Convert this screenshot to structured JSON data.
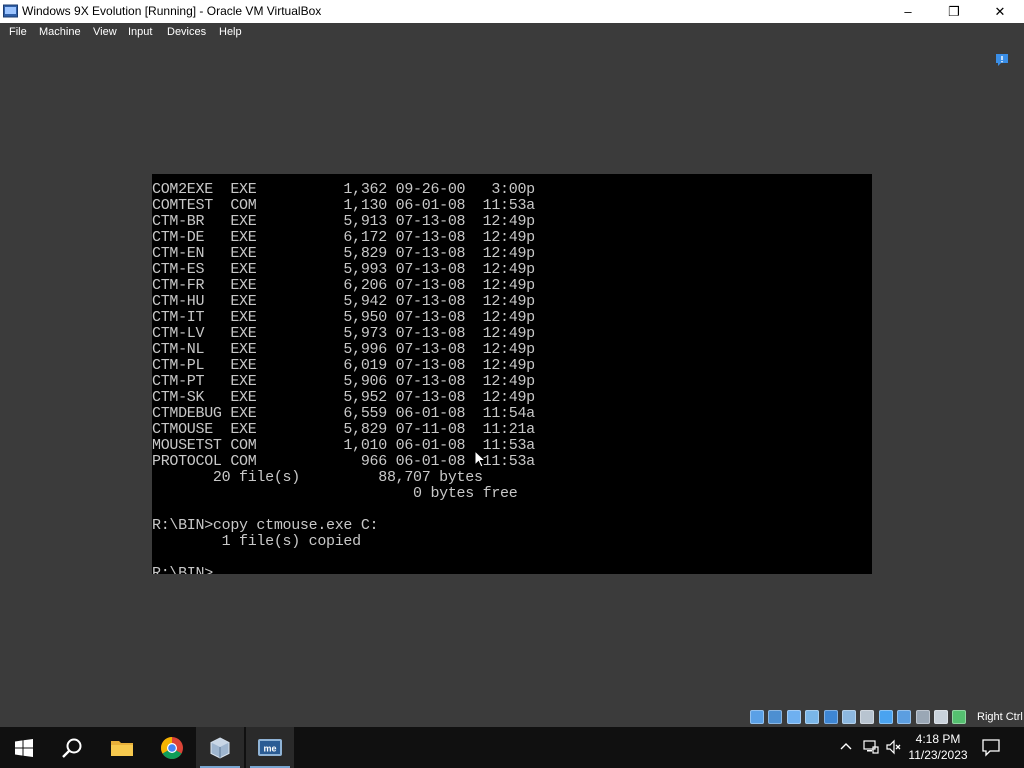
{
  "window": {
    "title": "Windows 9X Evolution [Running] - Oracle VM VirtualBox",
    "minimize": "–",
    "maximize": "❐",
    "close": "✕"
  },
  "menu": {
    "items": [
      "File",
      "Machine",
      "View",
      "Input",
      "Devices",
      "Help"
    ]
  },
  "console": {
    "lines": [
      "COM2EXE  EXE          1,362 09-26-00   3:00p",
      "COMTEST  COM          1,130 06-01-08  11:53a",
      "CTM-BR   EXE          5,913 07-13-08  12:49p",
      "CTM-DE   EXE          6,172 07-13-08  12:49p",
      "CTM-EN   EXE          5,829 07-13-08  12:49p",
      "CTM-ES   EXE          5,993 07-13-08  12:49p",
      "CTM-FR   EXE          6,206 07-13-08  12:49p",
      "CTM-HU   EXE          5,942 07-13-08  12:49p",
      "CTM-IT   EXE          5,950 07-13-08  12:49p",
      "CTM-LV   EXE          5,973 07-13-08  12:49p",
      "CTM-NL   EXE          5,996 07-13-08  12:49p",
      "CTM-PL   EXE          6,019 07-13-08  12:49p",
      "CTM-PT   EXE          5,906 07-13-08  12:49p",
      "CTM-SK   EXE          5,952 07-13-08  12:49p",
      "CTMDEBUG EXE          6,559 06-01-08  11:54a",
      "CTMOUSE  EXE          5,829 07-11-08  11:21a",
      "MOUSETST COM          1,010 06-01-08  11:53a",
      "PROTOCOL COM            966 06-01-08  11:53a",
      "       20 file(s)         88,707 bytes",
      "                              0 bytes free",
      "",
      "R:\\BIN>copy ctmouse.exe C:",
      "        1 file(s) copied",
      "",
      "R:\\BIN>_"
    ]
  },
  "statusbar": {
    "icons": [
      "hard-disk-icon",
      "optical-drive-icon",
      "floppy-icon",
      "audio-icon",
      "network-icon",
      "usb-icon",
      "shared-folder-icon",
      "display-icon",
      "video-capture-icon",
      "cpu-icon",
      "mouse-integration-icon",
      "keyboard-icon"
    ],
    "host_key": "Right Ctrl"
  },
  "taskbar": {
    "apps": [
      {
        "name": "start-button",
        "icon": "windows-logo-icon"
      },
      {
        "name": "search-button",
        "icon": "search-icon"
      },
      {
        "name": "file-explorer-button",
        "icon": "folder-icon"
      },
      {
        "name": "chrome-button",
        "icon": "chrome-icon"
      },
      {
        "name": "virtualbox-manager-button",
        "icon": "virtualbox-icon"
      },
      {
        "name": "vm-window-button",
        "icon": "windows-me-icon"
      }
    ],
    "clock": {
      "time": "4:18 PM",
      "date": "11/23/2023"
    }
  },
  "colors": {
    "desktop_bg": "#3b3b3b",
    "console_text": "#c8c8c8",
    "taskbar": "#101010"
  }
}
